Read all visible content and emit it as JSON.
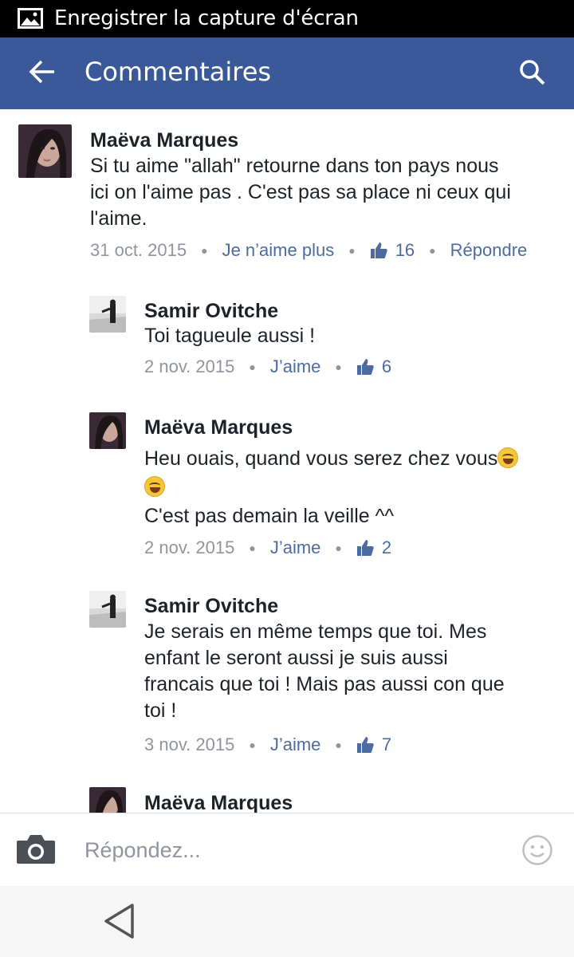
{
  "status_bar": {
    "text": "Enregistrer la capture d'écran",
    "icon": "image-icon"
  },
  "app_bar": {
    "title": "Commentaires",
    "back_icon": "arrow-left-icon",
    "search_icon": "search-icon",
    "color": "#3b5998"
  },
  "comments": [
    {
      "author": "Maëva Marques",
      "lines": [
        "Si tu aime \"allah\" retourne dans ton pays nous",
        "ici on l'aime pas . C'est pas sa place ni ceux qui",
        "l'aime."
      ],
      "date": "31 oct. 2015",
      "like_action": "Je n’aime plus",
      "likes": "16",
      "reply_action": "Répondre"
    },
    {
      "author": "Samir Ovitche",
      "lines": [
        "Toi tagueule aussi !"
      ],
      "date": "2 nov. 2015",
      "like_action": "J’aime",
      "likes": "6"
    },
    {
      "author": "Maëva Marques",
      "lines": [
        "Heu ouais, quand vous serez chez vous",
        "",
        "C'est pas demain la veille ^^"
      ],
      "date": "2 nov. 2015",
      "like_action": "J’aime",
      "likes": "2"
    },
    {
      "author": "Samir Ovitche",
      "lines": [
        "Je serais en même temps que toi. Mes",
        "enfant le seront aussi je suis aussi",
        "francais que toi ! Mais pas aussi con que",
        "toi !"
      ],
      "date": "3 nov. 2015",
      "like_action": "J’aime",
      "likes": "7"
    },
    {
      "author": "Maëva Marques"
    }
  ],
  "reply_bar": {
    "placeholder": "Répondez...",
    "camera_icon": "camera-icon",
    "emoji_icon": "smiley-icon"
  },
  "nav_bar": {
    "back_icon": "triangle-back-icon"
  },
  "colors": {
    "link": "#4b6ba1",
    "meta": "#90949c",
    "text": "#1d2129"
  }
}
